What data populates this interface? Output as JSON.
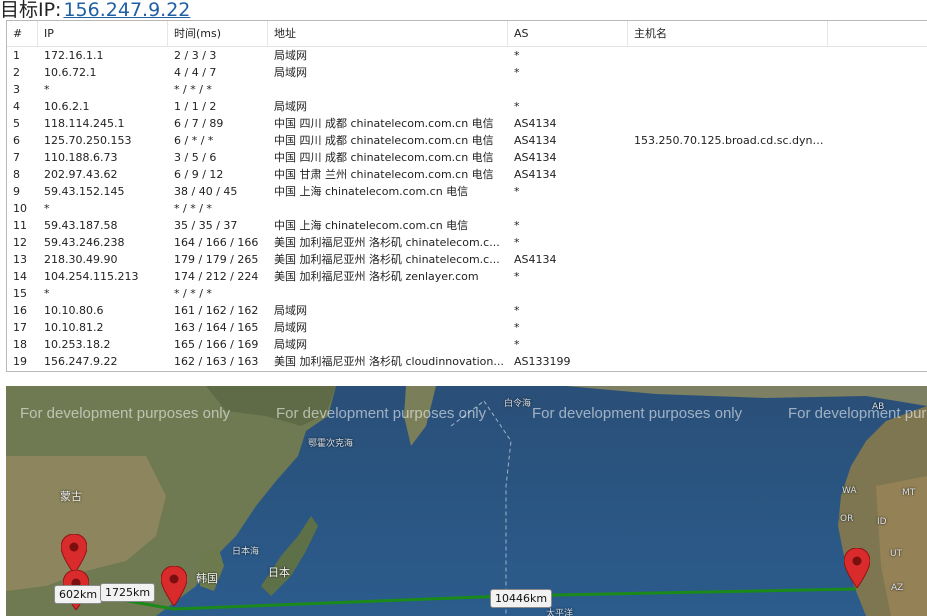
{
  "header": {
    "label": "目标IP:",
    "ip": "156.247.9.22"
  },
  "columns": [
    "#",
    "IP",
    "时间(ms)",
    "地址",
    "AS",
    "主机名"
  ],
  "rows": [
    {
      "num": "1",
      "ip": "172.16.1.1",
      "time": "2 / 3 / 3",
      "addr": "局域网",
      "as": "*",
      "host": ""
    },
    {
      "num": "2",
      "ip": "10.6.72.1",
      "time": "4 / 4 / 7",
      "addr": "局域网",
      "as": "*",
      "host": ""
    },
    {
      "num": "3",
      "ip": "*",
      "time": "* / * / *",
      "addr": "",
      "as": "",
      "host": ""
    },
    {
      "num": "4",
      "ip": "10.6.2.1",
      "time": "1 / 1 / 2",
      "addr": "局域网",
      "as": "*",
      "host": ""
    },
    {
      "num": "5",
      "ip": "118.114.245.1",
      "time": "6 / 7 / 89",
      "addr": "中国 四川 成都 chinatelecom.com.cn 电信",
      "as": "AS4134",
      "host": ""
    },
    {
      "num": "6",
      "ip": "125.70.250.153",
      "time": "6 / * / *",
      "addr": "中国 四川 成都 chinatelecom.com.cn 电信",
      "as": "AS4134",
      "host": "153.250.70.125.broad.cd.sc.dynam..."
    },
    {
      "num": "7",
      "ip": "110.188.6.73",
      "time": "3 / 5 / 6",
      "addr": "中国 四川 成都 chinatelecom.com.cn 电信",
      "as": "AS4134",
      "host": ""
    },
    {
      "num": "8",
      "ip": "202.97.43.62",
      "time": "6 / 9 / 12",
      "addr": "中国 甘肃 兰州 chinatelecom.com.cn 电信",
      "as": "AS4134",
      "host": ""
    },
    {
      "num": "9",
      "ip": "59.43.152.145",
      "time": "38 / 40 / 45",
      "addr": "中国 上海 chinatelecom.com.cn 电信",
      "as": "*",
      "host": ""
    },
    {
      "num": "10",
      "ip": "*",
      "time": "* / * / *",
      "addr": "",
      "as": "",
      "host": ""
    },
    {
      "num": "11",
      "ip": "59.43.187.58",
      "time": "35 / 35 / 37",
      "addr": "中国 上海 chinatelecom.com.cn 电信",
      "as": "*",
      "host": ""
    },
    {
      "num": "12",
      "ip": "59.43.246.238",
      "time": "164 / 166 / 166",
      "addr": "美国 加利福尼亚州 洛杉矶 chinatelecom.c...",
      "as": "*",
      "host": ""
    },
    {
      "num": "13",
      "ip": "218.30.49.90",
      "time": "179 / 179 / 265",
      "addr": "美国 加利福尼亚州 洛杉矶 chinatelecom.c...",
      "as": "AS4134",
      "host": ""
    },
    {
      "num": "14",
      "ip": "104.254.115.213",
      "time": "174 / 212 / 224",
      "addr": "美国 加利福尼亚州 洛杉矶 zenlayer.com",
      "as": "*",
      "host": ""
    },
    {
      "num": "15",
      "ip": "*",
      "time": "* / * / *",
      "addr": "",
      "as": "",
      "host": ""
    },
    {
      "num": "16",
      "ip": "10.10.80.6",
      "time": "161 / 162 / 162",
      "addr": "局域网",
      "as": "*",
      "host": ""
    },
    {
      "num": "17",
      "ip": "10.10.81.2",
      "time": "163 / 164 / 165",
      "addr": "局域网",
      "as": "*",
      "host": ""
    },
    {
      "num": "18",
      "ip": "10.253.18.2",
      "time": "165 / 166 / 169",
      "addr": "局域网",
      "as": "*",
      "host": ""
    },
    {
      "num": "19",
      "ip": "156.247.9.22",
      "time": "162 / 163 / 163",
      "addr": "美国 加利福尼亚州 洛杉矶 cloudinnovation...",
      "as": "AS133199",
      "host": ""
    }
  ],
  "map": {
    "watermark": "For development purposes only",
    "labels": {
      "mongolia": "蒙古",
      "korea": "韩国",
      "japan": "日本",
      "japan_sea": "日本海",
      "okhotsk": "鄂霍次克海",
      "aleutian": "白令海",
      "pacific": "太平洋",
      "wa": "WA",
      "mt": "MT",
      "or": "OR",
      "id": "ID",
      "ut": "UT",
      "az": "AZ",
      "ab": "AB"
    },
    "distances": {
      "d1": "602km",
      "d2": "1725km",
      "d3": "10446km"
    },
    "route_color": "#1a8a1a",
    "pin_color": "#d92b2b"
  }
}
